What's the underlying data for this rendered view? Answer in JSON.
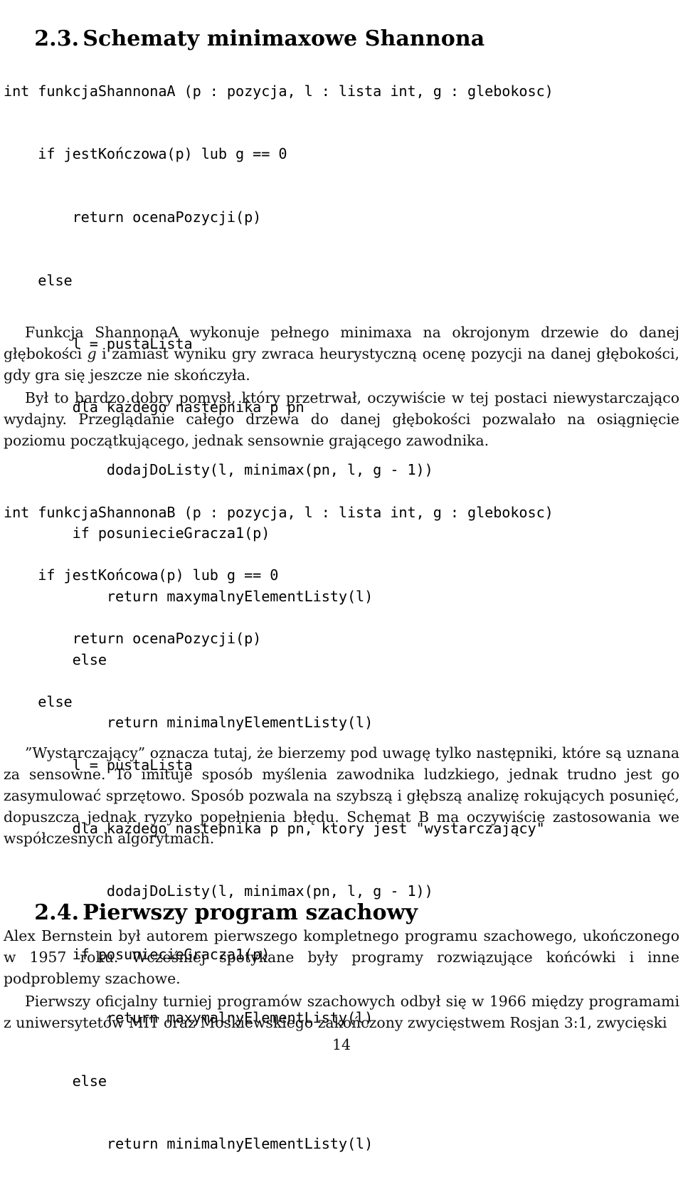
{
  "document": {
    "page_number": "14",
    "language": "pl"
  },
  "sections": {
    "s23": {
      "number": "2.3.",
      "title": "Schematy minimaxowe Shannona"
    },
    "s24": {
      "number": "2.4.",
      "title": "Pierwszy program szachowy"
    }
  },
  "code_a": {
    "lines": [
      "int funkcjaShannonaA (p : pozycja, l : lista int, g : glebokosc)",
      "    if jestKończowa(p) lub g == 0",
      "        return ocenaPozycji(p)",
      "    else",
      "        l = pustaLista",
      "        dla każdego nastepnika p pn",
      "            dodajDoListy(l, minimax(pn, l, g - 1))",
      "        if posuniecieGracza1(p)",
      "            return maxymalnyElementListy(l)",
      "        else",
      "            return minimalnyElementListy(l)"
    ]
  },
  "code_b": {
    "lines": [
      "int funkcjaShannonaB (p : pozycja, l : lista int, g : glebokosc)",
      "    if jestKońcowa(p) lub g == 0",
      "        return ocenaPozycji(p)",
      "    else",
      "        l = pustaLista",
      "        dla każdego nastepnika p pn, ktory jest \"wystarczający\"",
      "            dodajDoListy(l, minimax(pn, l, g - 1))",
      "        if posuniecieGracza1(p)",
      "            return maxymalnyElementListy(l)",
      "        else",
      "            return minimalnyElementListy(l)"
    ]
  },
  "paragraphs": {
    "funkcja": {
      "before_var": "Funkcja ShannonaA wykonuje pełnego minimaxa na okrojonym drzewie do danej głębokości ",
      "var": "g",
      "after_var": " i zamiast wyniku gry zwraca heurystyczną ocenę pozycji na danej głębokości, gdy gra się jeszcze nie skończyła."
    },
    "bylto": "Był to bardzo dobry pomysł, który przetrwał, oczywiście w tej postaci niewystarczająco wydajny. Przeglądanie całego drzewa do danej głębokości pozwalało na osiągnięcie poziomu początkującego, jednak sensownie grającego zawodnika.",
    "wystarcz": "”Wystarczający” oznacza tutaj, że bierzemy pod uwagę tylko następniki, które są uznana za sensowne. To imituje sposób myślenia zawodnika ludzkiego, jednak trudno jest go zasymulować sprzętowo. Sposób pozwala na szybszą i głębszą analizę rokujących posunięć, dopuszcza jednak ryzyko popełnienia błędu. Schemat B ma oczywiście zastosowania we współczesnych algorytmach.",
    "bernstein": "Alex Bernstein był autorem pierwszego kompletnego programu szachowego, ukończonego w 1957 roku. Wcześniej spotykane były programy rozwiązujące końcówki i inne podproblemy szachowe.",
    "turniej": "Pierwszy oficjalny turniej programów szachowych odbył się w 1966 między programami z uniwersytetów MIT oraz Moskiewskiego zakończony zwycięstwem Rosjan 3:1, zwycięski"
  },
  "colors": {
    "text": "#111111",
    "background": "#ffffff"
  }
}
